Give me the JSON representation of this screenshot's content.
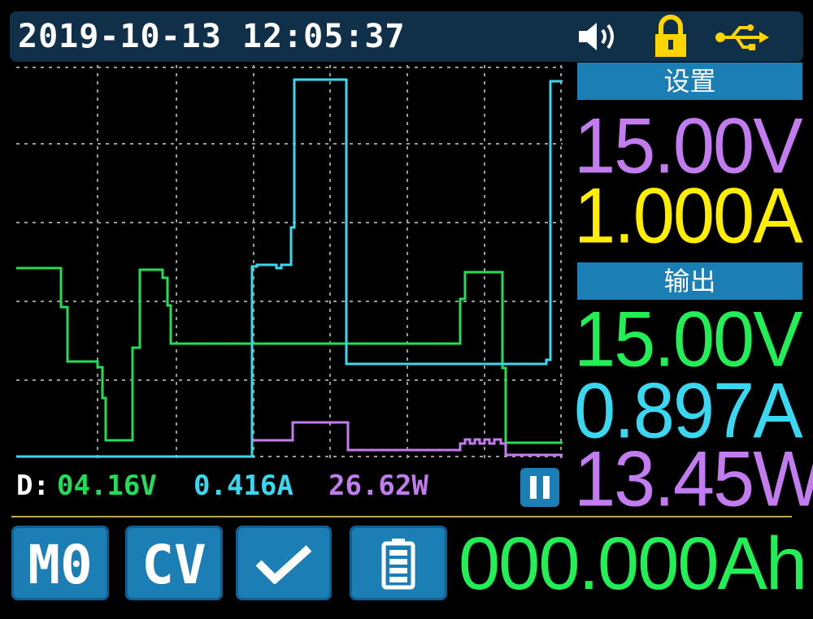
{
  "status_bar": {
    "datetime": "2019-10-13 12:05:37",
    "icons": [
      "speaker-icon",
      "lock-icon",
      "usb-icon"
    ],
    "lock_color": "#ffd400",
    "usb_color": "#ffd400"
  },
  "plot": {
    "series_colors": {
      "voltage": "#22dd55",
      "current": "#3ad8f0",
      "power": "#c27cf0"
    }
  },
  "readout": {
    "prefix": "D:",
    "voltage": "04.16V",
    "current": "0.416A",
    "power": "26.62W"
  },
  "settings": {
    "header": "设置",
    "voltage": "15.00V",
    "current": "1.000A"
  },
  "output": {
    "header": "输出",
    "voltage": "15.00V",
    "current": "0.897A",
    "power": "13.45W"
  },
  "buttons": {
    "memory": "M0",
    "mode": "CV",
    "confirm_icon": "check-icon",
    "battery_icon": "battery-icon"
  },
  "capacity": "000.000Ah",
  "colors": {
    "button_bg": "#1b7eb5",
    "voltage": "#22ee55",
    "set_voltage": "#c27cf0",
    "set_current": "#ffee00",
    "current": "#3ad8f0",
    "power": "#c27cf0"
  }
}
